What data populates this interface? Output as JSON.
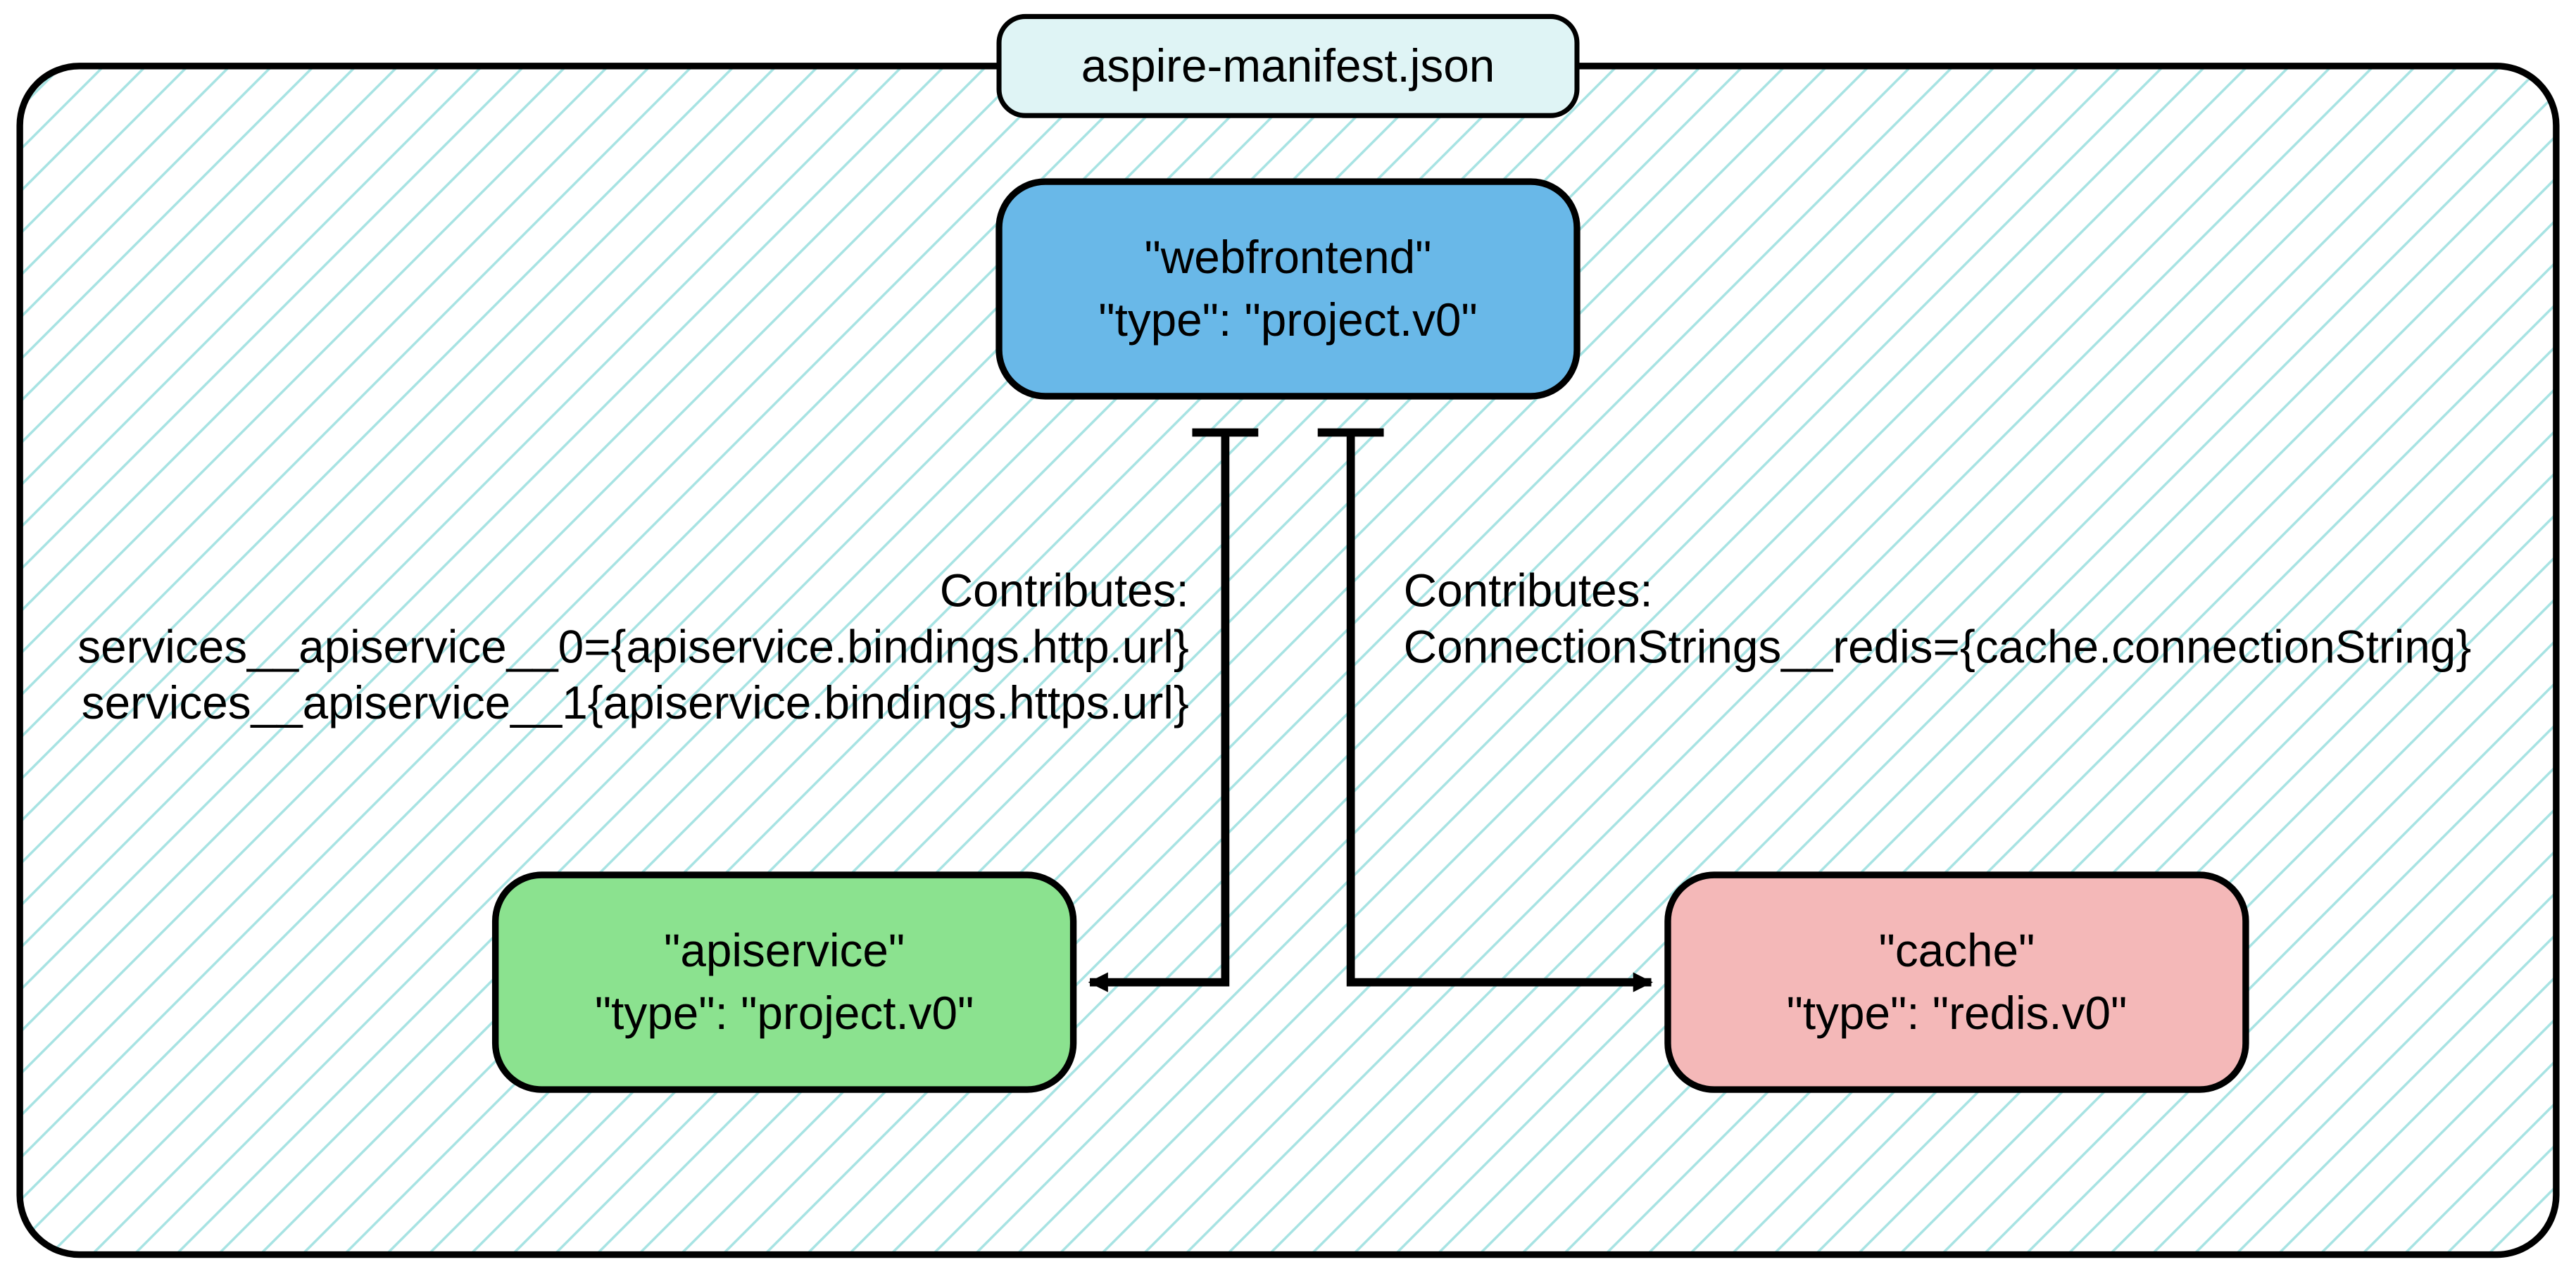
{
  "container": {
    "title": "aspire-manifest.json"
  },
  "nodes": {
    "webfrontend": {
      "line1": "\"webfrontend\"",
      "line2": "\"type\": \"project.v0\""
    },
    "apiservice": {
      "line1": "\"apiservice\"",
      "line2": "\"type\": \"project.v0\""
    },
    "cache": {
      "line1": "\"cache\"",
      "line2": "\"type\": \"redis.v0\""
    }
  },
  "edges": {
    "left": {
      "title": "Contributes:",
      "line1": "services__apiservice__0={apiservice.bindings.http.url}",
      "line2": "services__apiservice__1{apiservice.bindings.https.url}"
    },
    "right": {
      "title": "Contributes:",
      "line1": "ConnectionStrings__redis={cache.connectionString}"
    }
  },
  "colors": {
    "containerFill": "#dff4f5",
    "hatch": "#a7e3e3",
    "webfrontend": "#69b8e8",
    "apiservice": "#8be28f",
    "cache": "#f4b8b8",
    "stroke": "#000000"
  }
}
